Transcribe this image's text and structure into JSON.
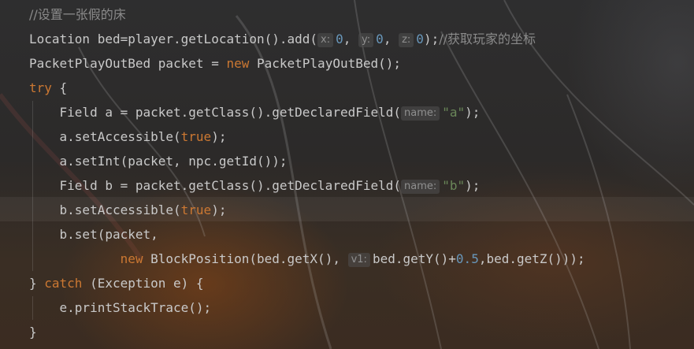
{
  "editor": {
    "current_line_index": 8,
    "lines": [
      [
        {
          "t": "//设置一张假的床",
          "c": "comment"
        }
      ],
      [
        {
          "t": "Location bed=player.getLocation().add(",
          "c": "text"
        },
        {
          "t": "x:",
          "c": "hint"
        },
        {
          "t": "0",
          "c": "number"
        },
        {
          "t": ", ",
          "c": "text"
        },
        {
          "t": "y:",
          "c": "hint"
        },
        {
          "t": "0",
          "c": "number"
        },
        {
          "t": ", ",
          "c": "text"
        },
        {
          "t": "z:",
          "c": "hint"
        },
        {
          "t": "0",
          "c": "number"
        },
        {
          "t": ");",
          "c": "text"
        },
        {
          "t": "//获取玩家的坐标",
          "c": "comment"
        }
      ],
      [
        {
          "t": "PacketPlayOutBed packet = ",
          "c": "text"
        },
        {
          "t": "new",
          "c": "keyword"
        },
        {
          "t": " PacketPlayOutBed();",
          "c": "text"
        }
      ],
      [
        {
          "t": "try",
          "c": "keyword"
        },
        {
          "t": " {",
          "c": "text"
        }
      ],
      [
        {
          "t": "    Field a = packet.getClass().getDeclaredField(",
          "c": "text"
        },
        {
          "t": "name:",
          "c": "hint"
        },
        {
          "t": "\"a\"",
          "c": "string"
        },
        {
          "t": ");",
          "c": "text"
        }
      ],
      [
        {
          "t": "    a.setAccessible(",
          "c": "text"
        },
        {
          "t": "true",
          "c": "keyword"
        },
        {
          "t": ");",
          "c": "text"
        }
      ],
      [
        {
          "t": "    a.setInt(packet, npc.getId());",
          "c": "text"
        }
      ],
      [
        {
          "t": "    Field b = packet.getClass().getDeclaredField(",
          "c": "text"
        },
        {
          "t": "name:",
          "c": "hint"
        },
        {
          "t": "\"b\"",
          "c": "string"
        },
        {
          "t": ");",
          "c": "text"
        }
      ],
      [
        {
          "t": "    b.setAccessible(",
          "c": "text"
        },
        {
          "t": "true",
          "c": "keyword"
        },
        {
          "t": ");",
          "c": "text"
        }
      ],
      [
        {
          "t": "    b.set(packet,",
          "c": "text"
        }
      ],
      [
        {
          "t": "            ",
          "c": "text"
        },
        {
          "t": "new",
          "c": "keyword"
        },
        {
          "t": " BlockPosition(bed.getX(), ",
          "c": "text"
        },
        {
          "t": "v1:",
          "c": "hint"
        },
        {
          "t": "bed.getY()+",
          "c": "text"
        },
        {
          "t": "0.5",
          "c": "number"
        },
        {
          "t": ",bed.getZ()));",
          "c": "text"
        }
      ],
      [
        {
          "t": "} ",
          "c": "text"
        },
        {
          "t": "catch",
          "c": "keyword"
        },
        {
          "t": " (Exception e) {",
          "c": "text"
        }
      ],
      [
        {
          "t": "    e.printStackTrace();",
          "c": "text"
        }
      ],
      [
        {
          "t": "}",
          "c": "text"
        }
      ]
    ]
  }
}
